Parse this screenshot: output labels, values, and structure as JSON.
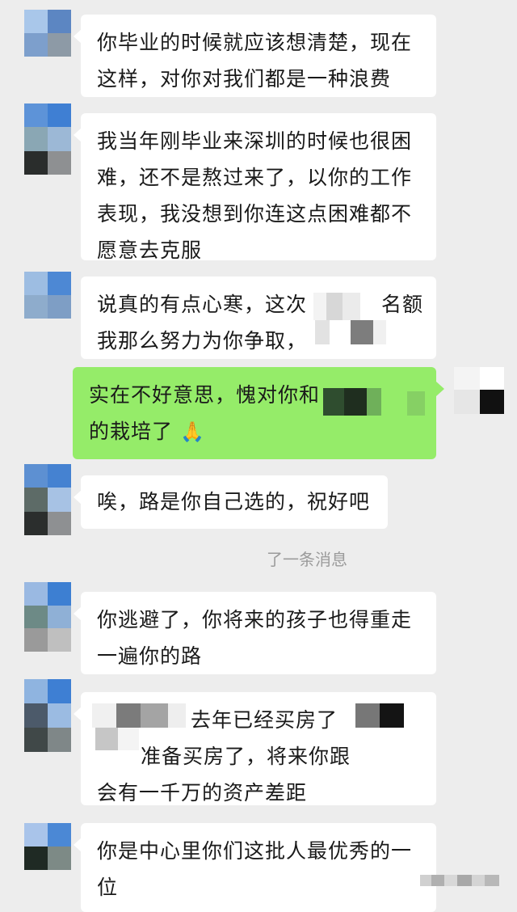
{
  "messages": [
    {
      "lines": [
        "你毕业的时候就应该想清楚，现在",
        "这样，对你对我们都是一种浪费"
      ]
    },
    {
      "lines": [
        "我当年刚毕业来深圳的时候也很困",
        "难，还不是熬过来了，以你的工作",
        "表现，我没想到你连这点困难都不",
        "愿意去克服"
      ]
    },
    {
      "lines": [
        "说真的有点心寒，这次",
        "我那么努力为你争取，"
      ],
      "fragment": "名额"
    },
    {
      "lines": [
        "实在不好意思，愧对你和",
        "的栽培了"
      ],
      "emoji": "🙏"
    },
    {
      "lines": [
        "唉，路是你自己选的，祝好吧"
      ]
    },
    {
      "lines": [
        "你逃避了，你将来的孩子也得重走",
        "一遍你的路"
      ]
    },
    {
      "lines": [
        "去年已经买房了",
        "准备买房了，将来你跟",
        "会有一千万的资产差距"
      ]
    },
    {
      "lines": [
        "你是中心里你们这批人最优秀的一",
        "位"
      ]
    }
  ],
  "system_message": "了一条消息",
  "colors": {
    "background": "#ededed",
    "incoming_bubble": "#ffffff",
    "outgoing_bubble": "#95ec69",
    "text": "#1a1a1a"
  }
}
